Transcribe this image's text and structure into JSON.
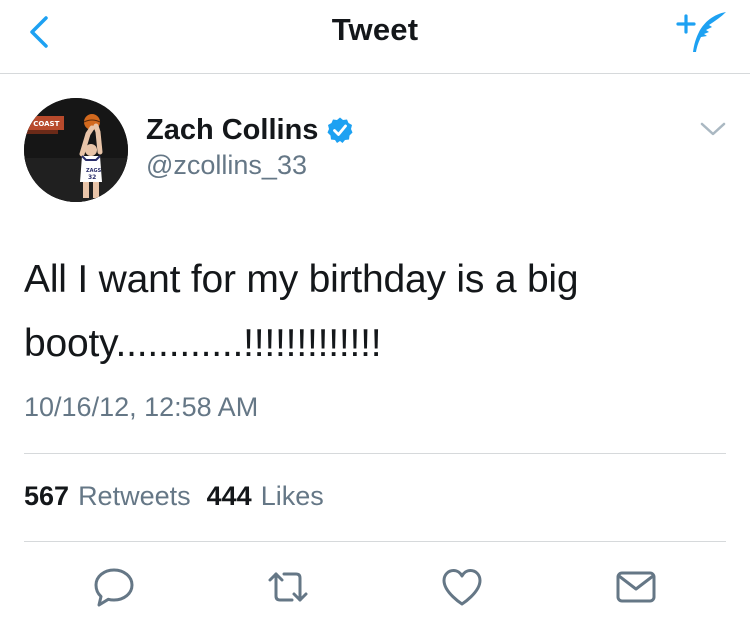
{
  "nav": {
    "title": "Tweet",
    "back_icon": "chevron-left-icon",
    "compose_icon": "compose-tweet-icon",
    "accent_color": "#1da1f2"
  },
  "tweet": {
    "author": {
      "display_name": "Zach Collins",
      "username": "@zcollins_33",
      "verified": true,
      "verified_color": "#1da1f2"
    },
    "text_line1": "All I want for my birthday is a big",
    "text_line2": "booty............!!!!!!!!!!!!!",
    "timestamp": "10/16/12, 12:58 AM",
    "stats": {
      "retweets_count": "567",
      "retweets_label": "Retweets",
      "likes_count": "444",
      "likes_label": "Likes"
    },
    "actions": [
      {
        "icon": "reply-icon"
      },
      {
        "icon": "retweet-icon"
      },
      {
        "icon": "heart-icon"
      },
      {
        "icon": "envelope-icon"
      }
    ]
  },
  "colors": {
    "text_primary": "#14171a",
    "text_secondary": "#657786",
    "divider": "#d6d9db",
    "icon_gray": "#657786"
  }
}
